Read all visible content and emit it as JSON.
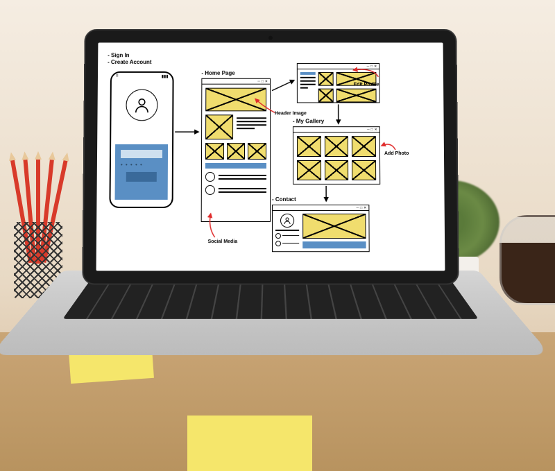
{
  "signin": {
    "item1": "- Sign In",
    "item2": "- Create Account"
  },
  "sections": {
    "home": "- Home Page",
    "gallery": "- My Gallery",
    "contact": "- Contact"
  },
  "annotations": {
    "edit_profile": "Edit Profile",
    "header_image": "Header Image",
    "add_photo": "Add Photo",
    "social_media": "Social Media"
  },
  "colors": {
    "placeholder": "#f0dd6e",
    "panel_blue": "#5a8fc4",
    "arrow_red": "#e02c2c"
  }
}
